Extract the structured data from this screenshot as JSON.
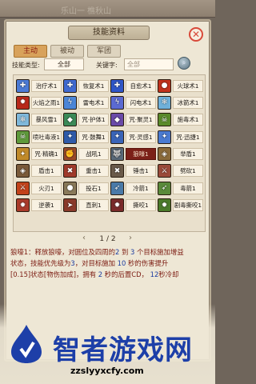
{
  "topbar": {
    "text": "乐山一  樵秋山"
  },
  "panel": {
    "title": "技能资料",
    "close_icon": "close-icon"
  },
  "tabs": [
    {
      "label": "主动",
      "active": true
    },
    {
      "label": "被动",
      "active": false
    },
    {
      "label": "军团",
      "active": false
    }
  ],
  "filter": {
    "type_label": "技能类型:",
    "type_value": "全部",
    "keyword_label": "关键字:",
    "keyword_value": "全部"
  },
  "skills": [
    {
      "name": "治疗术1",
      "color": "#4b7bd6",
      "icon": "✚"
    },
    {
      "name": "恢复术1",
      "color": "#3f6ad1",
      "icon": "✚"
    },
    {
      "name": "自愈术1",
      "color": "#2f56c8",
      "icon": "✚"
    },
    {
      "name": "火球术1",
      "color": "#c2321c",
      "icon": "●"
    },
    {
      "name": "火焰之雨1",
      "color": "#b8281a",
      "icon": "✹"
    },
    {
      "name": "雷电术1",
      "color": "#4b86d8",
      "icon": "ϟ"
    },
    {
      "name": "闪电术1",
      "color": "#5b6ad2",
      "icon": "ϟ"
    },
    {
      "name": "冰箭术1",
      "color": "#6fb0da",
      "icon": "❄"
    },
    {
      "name": "暴风雪1",
      "color": "#7fb8da",
      "icon": "❄"
    },
    {
      "name": "咒·护体1",
      "color": "#3b8a58",
      "icon": "◆"
    },
    {
      "name": "咒·聚灵1",
      "color": "#6a4aa8",
      "icon": "◆"
    },
    {
      "name": "施毒术1",
      "color": "#5a8a2a",
      "icon": "☠"
    },
    {
      "name": "喷吐毒液1",
      "color": "#5e9a3a",
      "icon": "☠"
    },
    {
      "name": "咒·鼓舞1",
      "color": "#2f5aa8",
      "icon": "✦"
    },
    {
      "name": "咒·灵感1",
      "color": "#3a64b8",
      "icon": "✦"
    },
    {
      "name": "咒·迅捷1",
      "color": "#4a7ad0",
      "icon": "✦"
    },
    {
      "name": "咒·精确1",
      "color": "#c08a2a",
      "icon": "✦"
    },
    {
      "name": "战吼1",
      "color": "#9a4a2a",
      "icon": "✊"
    },
    {
      "name": "狼嚎1",
      "color": "#5a6a7a",
      "icon": "🐺",
      "selected": true
    },
    {
      "name": "举盾1",
      "color": "#8a6a3a",
      "icon": "◈"
    },
    {
      "name": "盾击1",
      "color": "#7a5a3a",
      "icon": "◈"
    },
    {
      "name": "重击1",
      "color": "#a03a2a",
      "icon": "✖"
    },
    {
      "name": "锤击1",
      "color": "#6a5a4a",
      "icon": "✖"
    },
    {
      "name": "劈砍1",
      "color": "#9a4a3a",
      "icon": "⚔"
    },
    {
      "name": "火刃1",
      "color": "#c2421a",
      "icon": "⚔"
    },
    {
      "name": "投石1",
      "color": "#8a7a5a",
      "icon": "●"
    },
    {
      "name": "冷箭1",
      "color": "#4a7aa8",
      "icon": "➶"
    },
    {
      "name": "毒箭1",
      "color": "#5a8a3a",
      "icon": "➶"
    },
    {
      "name": "逆袭1",
      "color": "#aa3a2a",
      "icon": "✹"
    },
    {
      "name": "直刺1",
      "color": "#8a3a2a",
      "icon": "➤"
    },
    {
      "name": "撕咬1",
      "color": "#7a2a2a",
      "icon": "✹"
    },
    {
      "name": "剧毒撕咬1",
      "color": "#4a7a2a",
      "icon": "✹"
    }
  ],
  "pager": {
    "text": "1 / 2",
    "prev_icon": "arrow-left-icon",
    "next_icon": "arrow-right-icon"
  },
  "description": {
    "skill_name": "狼嚎1",
    "line1": "：释放狼嚎，对圆位及四周的",
    "n1": "2",
    "line1b": " 到 ",
    "n2": "3",
    "line1c": " 个目标施加增益",
    "line2": "状态，技能优先级为",
    "n3": "3",
    "line2b": "，对目标施加",
    "n4": "10",
    "line2c": " 秒的伤害提升",
    "line3": "[0.15]状态[物伤加成]，拥有",
    "n5": "2",
    "line3b": " 秒的后置CD，",
    "n6": "12",
    "line3c": "秒冷却"
  },
  "watermark": {
    "title": "智者游戏网",
    "url": "zzslyyxcfy.com"
  }
}
